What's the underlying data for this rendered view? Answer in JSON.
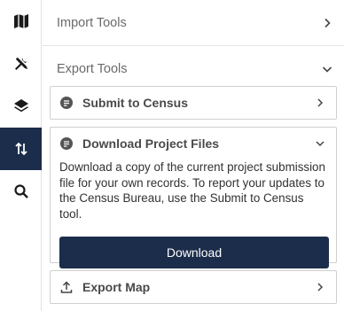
{
  "rail": {
    "items": [
      {
        "icon": "map-icon"
      },
      {
        "icon": "tools-icon"
      },
      {
        "icon": "layers-icon"
      },
      {
        "icon": "transfer-icon",
        "active": true
      },
      {
        "icon": "search-icon"
      }
    ]
  },
  "sections": {
    "import_label": "Import Tools",
    "export_label": "Export Tools"
  },
  "cards": {
    "submit": {
      "title": "Submit to Census",
      "icon": "census-icon"
    },
    "download": {
      "title": "Download Project Files",
      "icon": "census-icon",
      "description": "Download a copy of the current project submission file for your own records. To report your updates to the Census Bureau, use the Submit to Census tool.",
      "button_label": "Download"
    },
    "export_map": {
      "title": "Export Map",
      "icon": "upload-icon"
    }
  },
  "colors": {
    "accent": "#1b2d4b",
    "border": "#cfcfcf",
    "muted_text": "#6a6a6a"
  }
}
